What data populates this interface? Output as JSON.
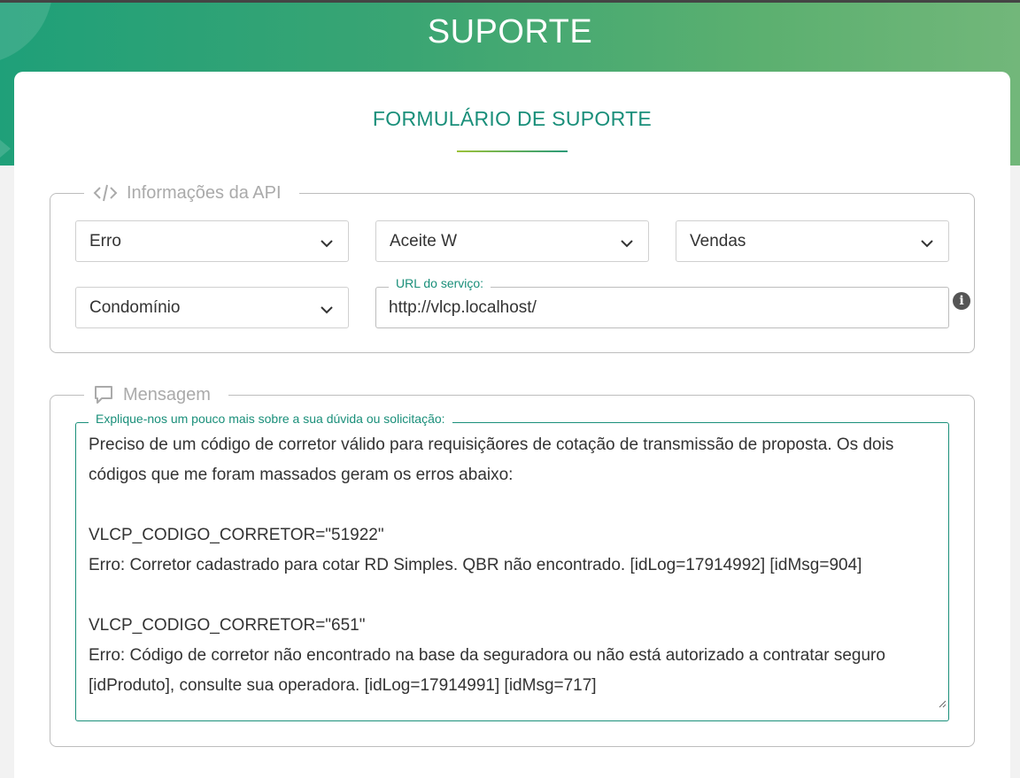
{
  "header": {
    "title": "SUPORTE"
  },
  "form": {
    "title": "FORMULÁRIO DE SUPORTE"
  },
  "api_section": {
    "legend": "Informações da API",
    "selects": {
      "tipo": "Erro",
      "produto": "Aceite W",
      "area": "Vendas",
      "ramo": "Condomínio"
    },
    "url": {
      "label": "URL do serviço:",
      "value": "http://vlcp.localhost/"
    }
  },
  "message_section": {
    "legend": "Mensagem",
    "label": "Explique-nos um pouco mais sobre a sua dúvida ou solicitação:",
    "lines": [
      "Preciso de um código de corretor válido para requisiçãores de cotação de transmissão de proposta. Os dois",
      "códigos que me foram massados geram os erros abaixo:",
      "",
      "VLCP_CODIGO_CORRETOR=\"51922\"",
      "Erro: Corretor cadastrado para cotar RD Simples. QBR não encontrado. [idLog=17914992] [idMsg=904]",
      "",
      "VLCP_CODIGO_CORRETOR=\"651\"",
      "Erro: Código de corretor não encontrado na base da seguradora ou não está autorizado a contratar seguro",
      "[idProduto], consulte sua operadora. [idLog=17914991] [idMsg=717]"
    ]
  },
  "colors": {
    "accent": "#1a8f7a",
    "header_gradient_start": "#1fa079",
    "header_gradient_end": "#72b77a"
  },
  "icons": {
    "api_legend": "code-icon",
    "message_legend": "comment-icon",
    "url_help": "info-icon",
    "select_arrow": "chevron-down-icon"
  }
}
